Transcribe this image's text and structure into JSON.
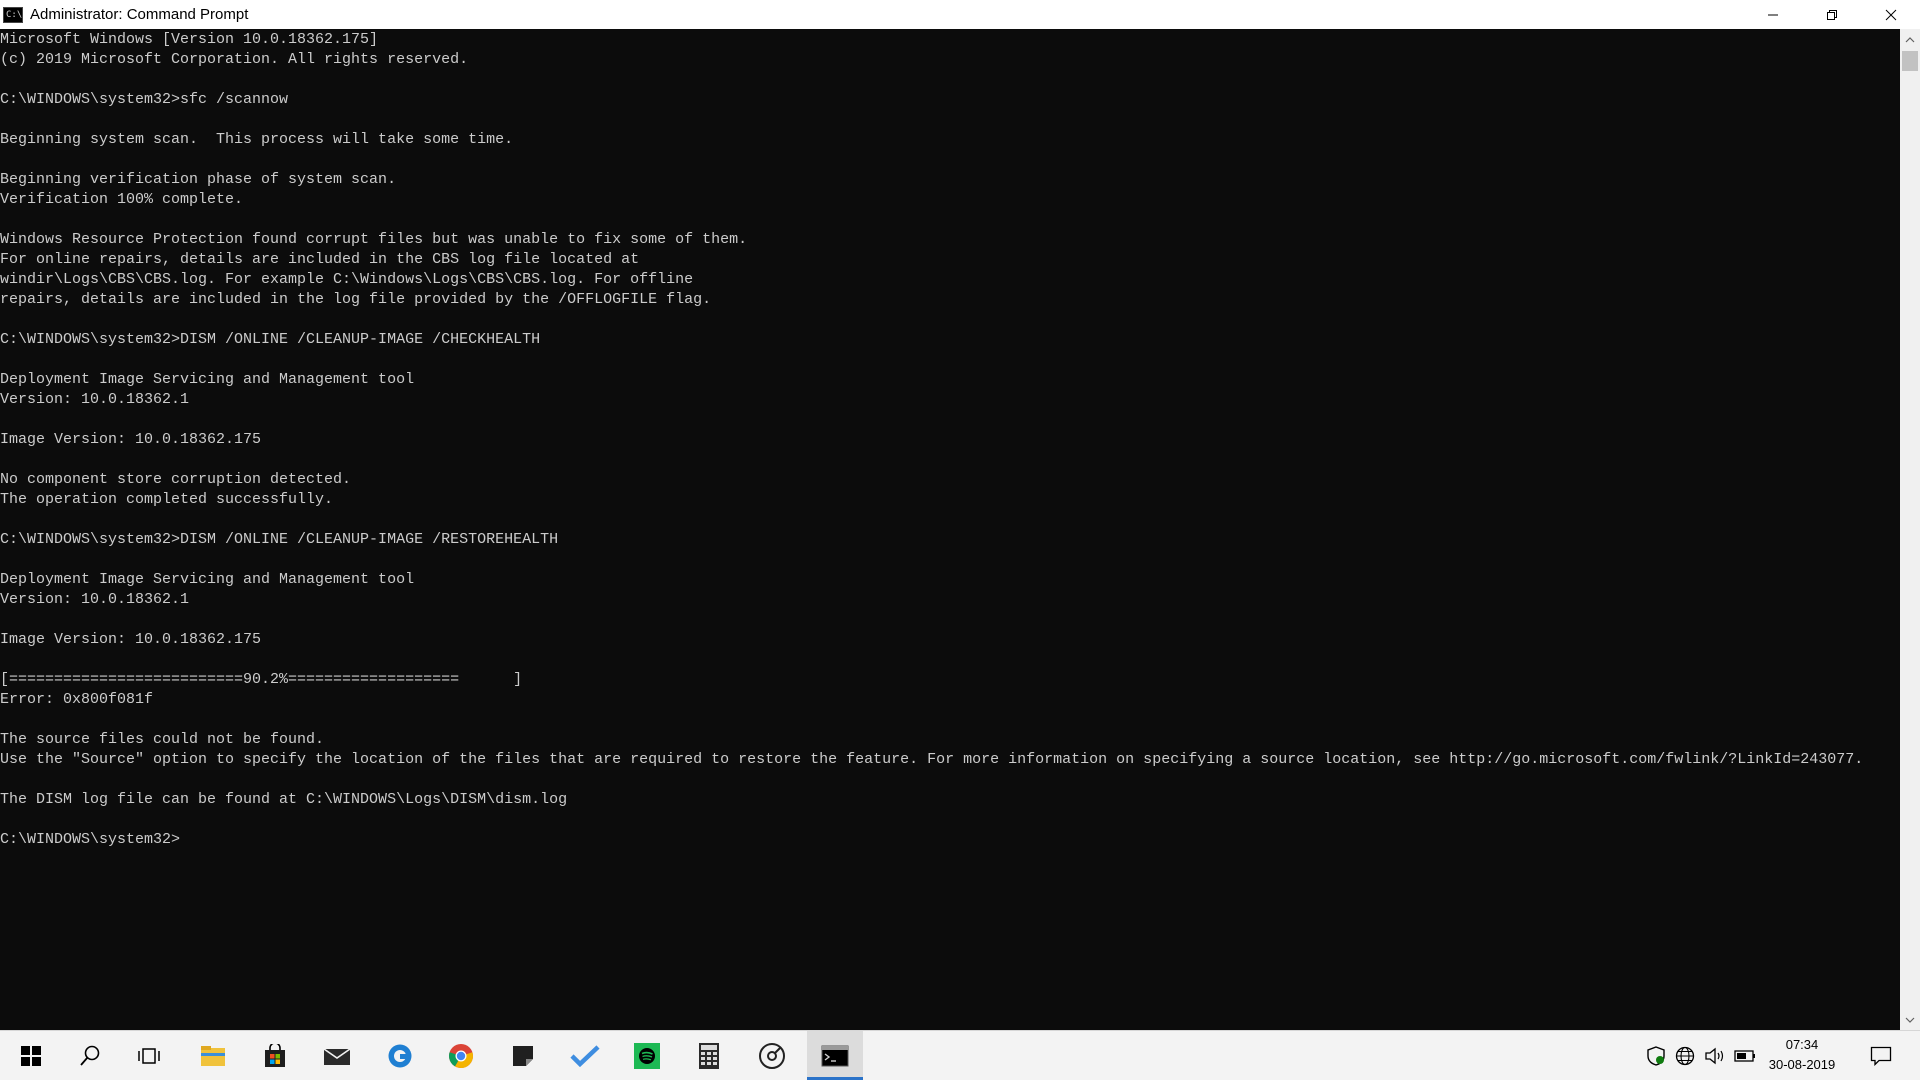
{
  "window": {
    "title": "Administrator: Command Prompt",
    "icon_label": "C:\\"
  },
  "console_lines": [
    "Microsoft Windows [Version 10.0.18362.175]",
    "(c) 2019 Microsoft Corporation. All rights reserved.",
    "",
    "C:\\WINDOWS\\system32>sfc /scannow",
    "",
    "Beginning system scan.  This process will take some time.",
    "",
    "Beginning verification phase of system scan.",
    "Verification 100% complete.",
    "",
    "Windows Resource Protection found corrupt files but was unable to fix some of them.",
    "For online repairs, details are included in the CBS log file located at",
    "windir\\Logs\\CBS\\CBS.log. For example C:\\Windows\\Logs\\CBS\\CBS.log. For offline",
    "repairs, details are included in the log file provided by the /OFFLOGFILE flag.",
    "",
    "C:\\WINDOWS\\system32>DISM /ONLINE /CLEANUP-IMAGE /CHECKHEALTH",
    "",
    "Deployment Image Servicing and Management tool",
    "Version: 10.0.18362.1",
    "",
    "Image Version: 10.0.18362.175",
    "",
    "No component store corruption detected.",
    "The operation completed successfully.",
    "",
    "C:\\WINDOWS\\system32>DISM /ONLINE /CLEANUP-IMAGE /RESTOREHEALTH",
    "",
    "Deployment Image Servicing and Management tool",
    "Version: 10.0.18362.1",
    "",
    "Image Version: 10.0.18362.175",
    "",
    "[==========================90.2%===================      ]",
    "Error: 0x800f081f",
    "",
    "The source files could not be found.",
    "Use the \"Source\" option to specify the location of the files that are required to restore the feature. For more information on specifying a source location, see http://go.microsoft.com/fwlink/?LinkId=243077.",
    "",
    "The DISM log file can be found at C:\\WINDOWS\\Logs\\DISM\\dism.log",
    "",
    "C:\\WINDOWS\\system32>"
  ],
  "taskbar": {
    "apps": [
      {
        "name": "start-icon"
      },
      {
        "name": "search-icon"
      },
      {
        "name": "task-view-icon"
      },
      {
        "name": "file-explorer-icon"
      },
      {
        "name": "store-icon"
      },
      {
        "name": "mail-icon"
      },
      {
        "name": "edge-icon"
      },
      {
        "name": "chrome-icon"
      },
      {
        "name": "sticky-notes-icon"
      },
      {
        "name": "todo-icon"
      },
      {
        "name": "spotify-icon"
      },
      {
        "name": "calculator-icon"
      },
      {
        "name": "groove-music-icon"
      },
      {
        "name": "command-prompt-icon",
        "active": true
      }
    ],
    "clock": {
      "time": "07:34",
      "date": "30-08-2019"
    }
  },
  "colors": {
    "console_bg": "#0c0c0c",
    "console_text": "#cccccc",
    "taskbar_bg": "#f3f3f3",
    "accent": "#2b73c9"
  }
}
